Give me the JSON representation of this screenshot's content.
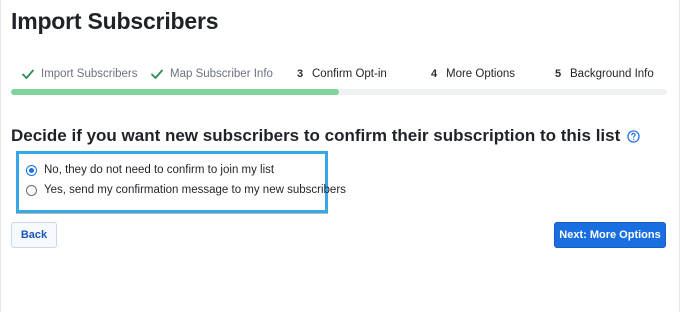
{
  "page": {
    "title": "Import Subscribers"
  },
  "steps": [
    {
      "label": "Import Subscribers",
      "status": "done",
      "number": ""
    },
    {
      "label": "Map Subscriber Info",
      "status": "done",
      "number": ""
    },
    {
      "label": "Confirm Opt-in",
      "status": "active",
      "number": "3"
    },
    {
      "label": "More Options",
      "status": "todo",
      "number": "4"
    },
    {
      "label": "Background Info",
      "status": "todo",
      "number": "5"
    }
  ],
  "progress": {
    "fraction": 0.5
  },
  "question": {
    "text": "Decide if you want new subscribers to confirm their subscription to this list",
    "help_icon": "help-circle-icon"
  },
  "options": [
    {
      "label": "No, they do not need to confirm to join my list",
      "selected": true
    },
    {
      "label": "Yes, send my confirmation message to my new subscribers",
      "selected": false
    }
  ],
  "buttons": {
    "back_label": "Back",
    "next_label": "Next: More Options"
  },
  "colors": {
    "progress": "#7fd499",
    "primary": "#1a6fe0",
    "highlight_border": "#35a8e8",
    "check": "#2e8b57"
  }
}
